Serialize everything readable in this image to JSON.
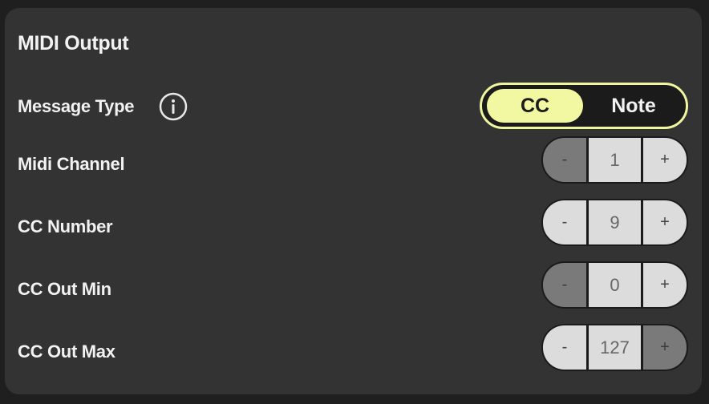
{
  "title": "MIDI Output",
  "message_type": {
    "label": "Message Type",
    "options": [
      "CC",
      "Note"
    ],
    "selected": "CC"
  },
  "rows": [
    {
      "label": "Midi Channel",
      "minus": "-",
      "value": "1",
      "plus": "+",
      "minus_disabled": true,
      "plus_disabled": false
    },
    {
      "label": "CC Number",
      "minus": "-",
      "value": "9",
      "plus": "+",
      "minus_disabled": false,
      "plus_disabled": false
    },
    {
      "label": "CC Out Min",
      "minus": "-",
      "value": "0",
      "plus": "+",
      "minus_disabled": true,
      "plus_disabled": false
    },
    {
      "label": "CC Out Max",
      "minus": "-",
      "value": "127",
      "plus": "+",
      "minus_disabled": false,
      "plus_disabled": true
    }
  ],
  "colors": {
    "accent": "#f2f7a2",
    "panel": "#333333",
    "background": "#1f1f1f"
  },
  "icons": {
    "info": "info-icon"
  }
}
